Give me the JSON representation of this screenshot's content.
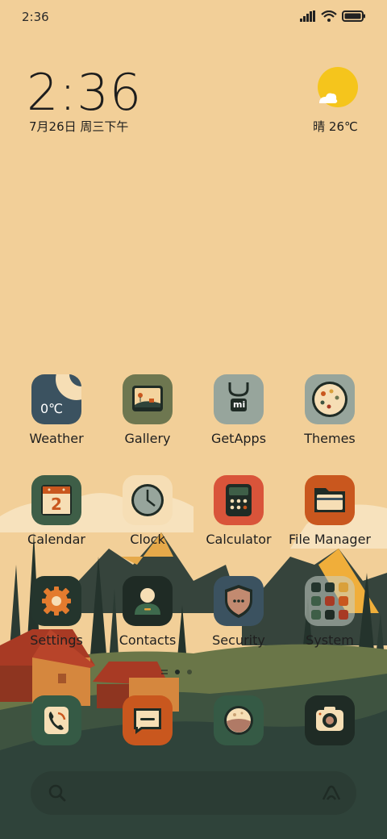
{
  "status_bar": {
    "time": "2:36",
    "icons": [
      "signal-icon",
      "wifi-icon",
      "battery-icon"
    ]
  },
  "clock_widget": {
    "time": "2:36",
    "date": "7月26日 周三下午"
  },
  "weather_widget": {
    "condition_icon": "sun-cloud-icon",
    "text": "晴 26℃"
  },
  "apps": [
    {
      "label": "Weather",
      "icon_text": "0℃"
    },
    {
      "label": "Gallery"
    },
    {
      "label": "GetApps",
      "icon_text": "mi"
    },
    {
      "label": "Themes"
    },
    {
      "label": "Calendar",
      "icon_text": "2"
    },
    {
      "label": "Clock"
    },
    {
      "label": "Calculator"
    },
    {
      "label": "File Manager"
    },
    {
      "label": "Settings"
    },
    {
      "label": "Contacts"
    },
    {
      "label": "Security"
    },
    {
      "label": "System"
    }
  ],
  "dock": [
    {
      "name": "phone"
    },
    {
      "name": "messages"
    },
    {
      "name": "browser"
    },
    {
      "name": "camera"
    }
  ],
  "pager": {
    "pages": 2,
    "active": 1
  },
  "colors": {
    "background": "#F2CF98",
    "hill_dark": "#2F433A",
    "roof": "#A83A24",
    "dock_green": "#355A45",
    "accent_orange": "#C9571E"
  }
}
